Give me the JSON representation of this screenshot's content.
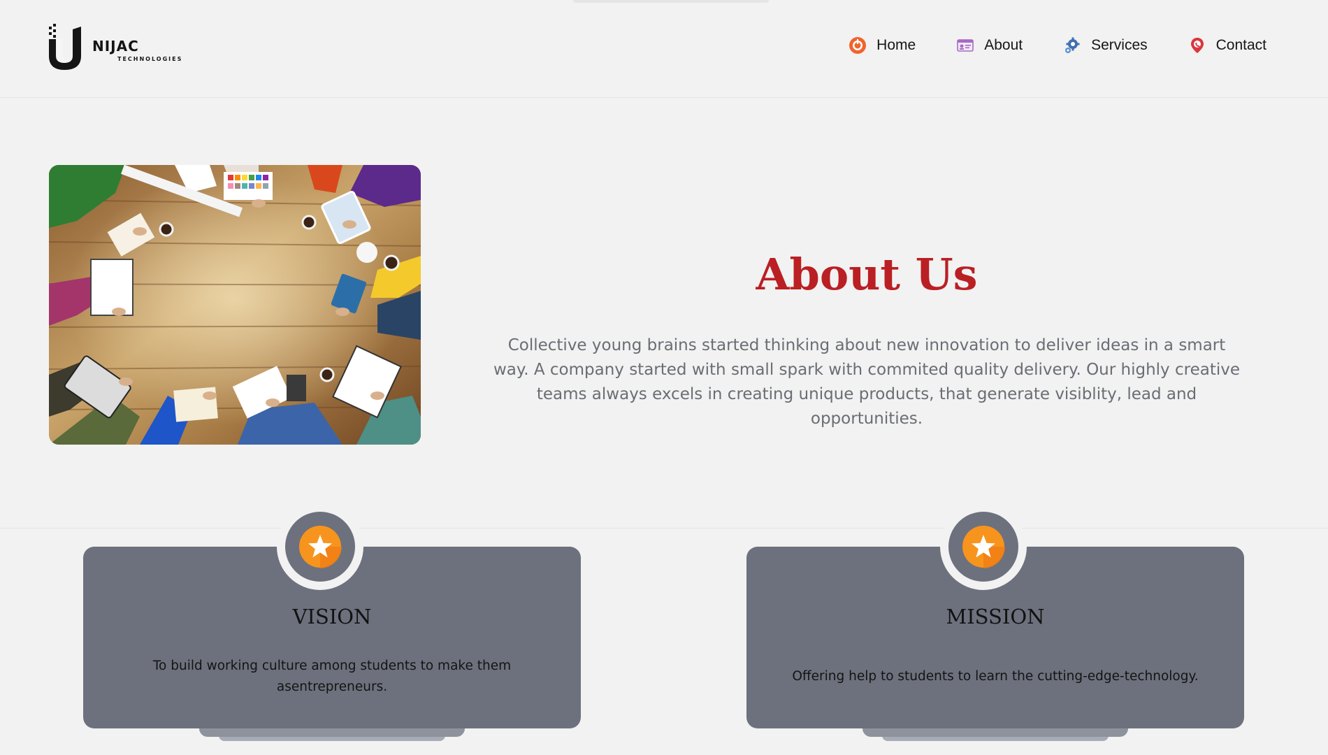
{
  "brand": {
    "name": "NIJAC",
    "tagline": "TECHNOLOGIES",
    "logo_icon": "unijac-u-logo"
  },
  "nav": {
    "items": [
      {
        "label": "Home",
        "icon": "home-icon",
        "color": "#f0642d"
      },
      {
        "label": "About",
        "icon": "id-card-icon",
        "color": "#a66bc4"
      },
      {
        "label": "Services",
        "icon": "gear-icon",
        "color": "#3f6fb0"
      },
      {
        "label": "Contact",
        "icon": "location-pin-icon",
        "color": "#d9363e"
      }
    ]
  },
  "about": {
    "title": "About Us",
    "text": "Collective young brains started thinking about new innovation to deliver ideas in a smart way. A company started with small spark with commited quality delivery. Our highly creative teams always excels in creating unique products, that generate visiblity, lead and opportunities.",
    "image": "team-meeting-table-photo"
  },
  "cards": {
    "vision": {
      "title": "VISION",
      "text": "To build working culture among students to make them asentrepreneurs.",
      "icon": "star-icon"
    },
    "mission": {
      "title": "MISSION",
      "text": "Offering help to students to learn the cutting-edge-technology.",
      "icon": "star-icon"
    }
  },
  "colors": {
    "background": "#f1f2f1",
    "title_red": "#ba1f24",
    "card_gray": "#6c717d",
    "star_orange": "#f7941d"
  }
}
